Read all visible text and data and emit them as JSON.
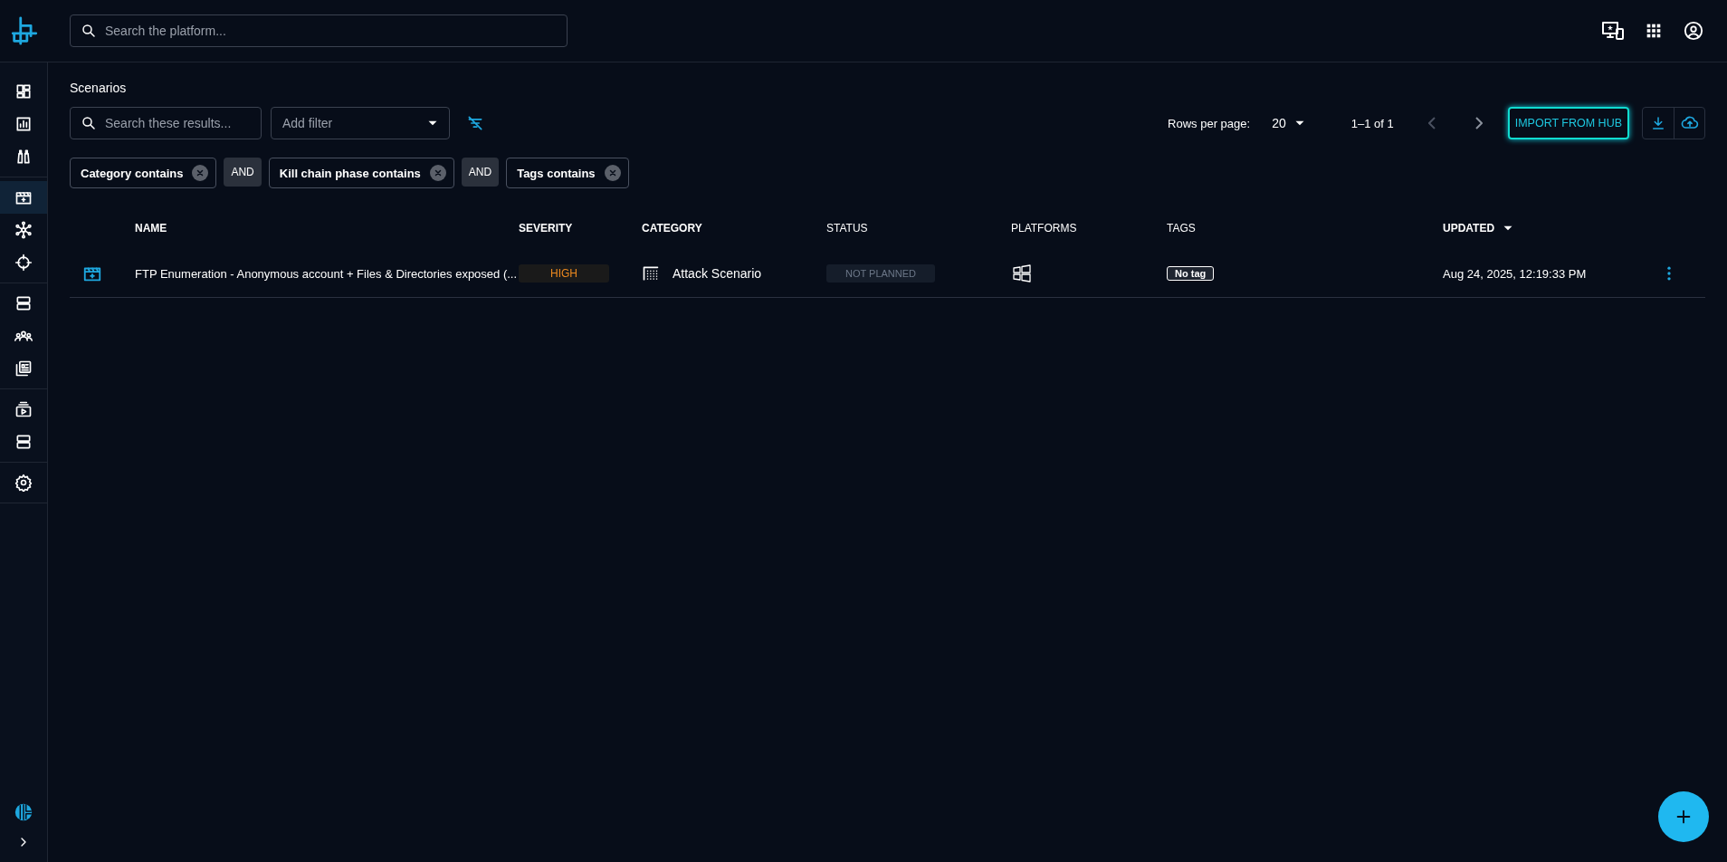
{
  "topbar": {
    "search": {
      "placeholder": "Search the platform..."
    }
  },
  "sidebar": {
    "groups": [
      [
        {
          "selected": false
        },
        {
          "selected": false
        },
        {
          "selected": false
        }
      ],
      [
        {
          "selected": true
        },
        {
          "selected": false
        },
        {
          "selected": false
        }
      ],
      [
        {
          "selected": false
        },
        {
          "selected": false
        },
        {
          "selected": false
        }
      ],
      [
        {
          "selected": false
        },
        {
          "selected": false
        }
      ],
      [
        {
          "selected": false
        }
      ]
    ]
  },
  "page_title": "Scenarios",
  "toolbar": {
    "search": {
      "placeholder": "Search these results..."
    },
    "filter_select": {
      "placeholder": "Add filter"
    },
    "rows_per_page_label": "Rows per page:",
    "rows_per_page": "20",
    "range": "1–1 of 1",
    "prev_disabled": true,
    "next_disabled": false,
    "import_button": "IMPORT FROM HUB"
  },
  "filters": [
    {
      "kind": "filter",
      "label": "Category contains"
    },
    {
      "kind": "operator",
      "label": "AND"
    },
    {
      "kind": "filter",
      "label": "Kill chain phase contains"
    },
    {
      "kind": "operator",
      "label": "AND"
    },
    {
      "kind": "filter",
      "label": "Tags contains"
    }
  ],
  "table": {
    "columns": [
      {
        "label": "NAME",
        "sortable": true,
        "sorted": false
      },
      {
        "label": "SEVERITY",
        "sortable": true,
        "sorted": false
      },
      {
        "label": "CATEGORY",
        "sortable": true,
        "sorted": false
      },
      {
        "label": "STATUS",
        "sortable": false,
        "sorted": false
      },
      {
        "label": "PLATFORMS",
        "sortable": false,
        "sorted": false
      },
      {
        "label": "TAGS",
        "sortable": false,
        "sorted": false
      },
      {
        "label": "UPDATED",
        "sortable": true,
        "sorted": true
      }
    ],
    "rows": [
      {
        "name": "FTP Enumeration - Anonymous account + Files & Directories exposed (...",
        "severity": "HIGH",
        "category": "Attack Scenario",
        "status": "NOT PLANNED",
        "tags": [
          "No tag"
        ],
        "updated": "Aug 24, 2025, 12:19:33 PM"
      }
    ]
  }
}
